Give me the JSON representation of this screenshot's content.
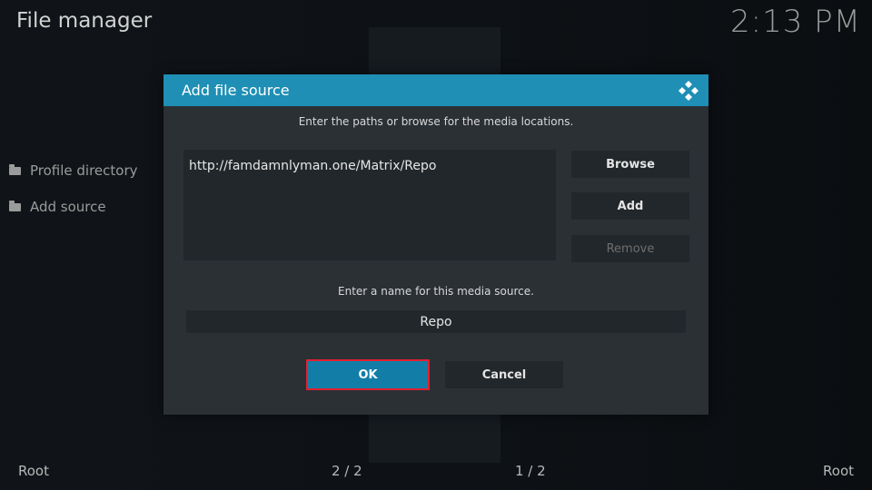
{
  "header": {
    "app_title": "File manager",
    "clock": "2:13 PM"
  },
  "sidebar": {
    "items": [
      {
        "label": "Profile directory",
        "icon": "folder-icon"
      },
      {
        "label": "Add source",
        "icon": "folder-icon"
      }
    ]
  },
  "footer": {
    "left_label": "Root",
    "left_count": "2 / 2",
    "right_count": "1 / 2",
    "right_label": "Root"
  },
  "dialog": {
    "title": "Add file source",
    "logo_icon": "kodi-logo-icon",
    "paths_hint": "Enter the paths or browse for the media locations.",
    "paths": [
      "http://famdamnlyman.one/Matrix/Repo"
    ],
    "browse_label": "Browse",
    "add_label": "Add",
    "remove_label": "Remove",
    "name_hint": "Enter a name for this media source.",
    "name_value": "Repo",
    "ok_label": "OK",
    "cancel_label": "Cancel"
  },
  "colors": {
    "accent": "#1f8fb5",
    "focus": "#127ea8",
    "highlight_border": "#e2202f"
  }
}
